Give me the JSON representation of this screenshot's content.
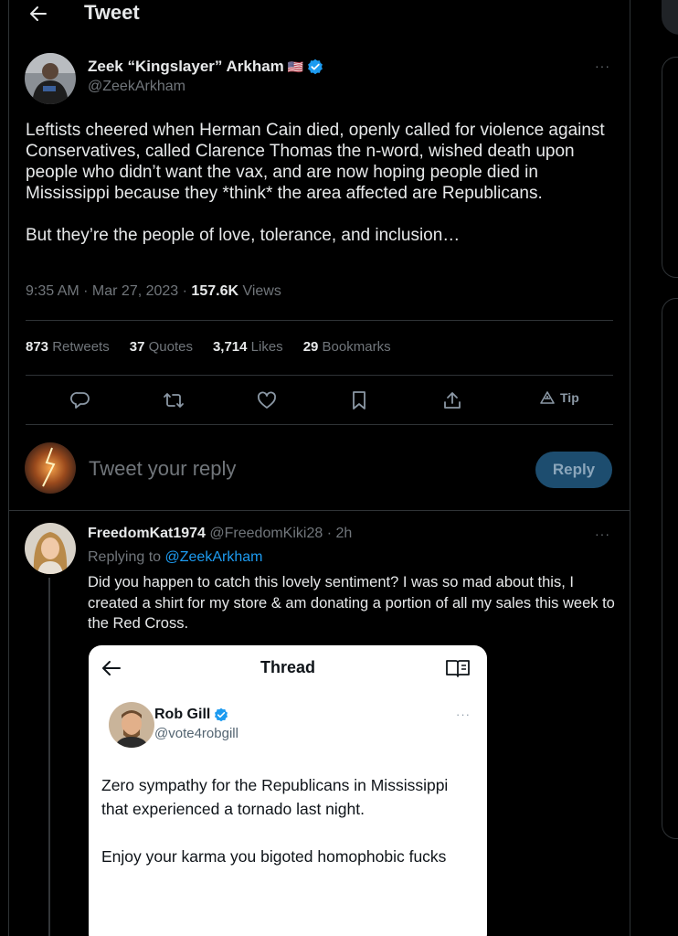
{
  "header": {
    "title": "Tweet"
  },
  "tweet": {
    "author_name": "Zeek “Kingslayer” Arkham",
    "author_flag": "🇺🇸",
    "author_handle": "@ZeekArkham",
    "more": "···",
    "text": "Leftists cheered when Herman Cain died, openly called for violence against Conservatives, called Clarence Thomas the n-word, wished death upon people who didn’t want the vax, and are now hoping people died in Mississippi because they *think* the area affected are Republicans.\n\nBut they’re the people of love, tolerance, and inclusion…",
    "time": "9:35 AM · Mar 27, 2023 · ",
    "views_count": "157.6K",
    "views_label": " Views",
    "stats": [
      {
        "count": "873",
        "label": " Retweets"
      },
      {
        "count": "37",
        "label": " Quotes"
      },
      {
        "count": "3,714",
        "label": " Likes"
      },
      {
        "count": "29",
        "label": " Bookmarks"
      }
    ],
    "tip_label": "Tip"
  },
  "compose": {
    "placeholder": "Tweet your reply",
    "button_label": "Reply"
  },
  "reply": {
    "name": "FreedomKat1974",
    "handle_time": " @FreedomKiki28 · 2h",
    "replying_prefix": "Replying to ",
    "replying_handle": "@ZeekArkham",
    "more": "···",
    "text": "Did you happen to catch this lovely sentiment? I was so mad about this, I created a shirt for my store & am donating a portion of all my sales this week to the Red Cross."
  },
  "embedded": {
    "title": "Thread",
    "name": "Rob Gill",
    "handle": "@vote4robgill",
    "more": "···",
    "text": "Zero sympathy for the Republicans in Mississippi that experienced a tornado last night.\n\nEnjoy your karma you bigoted homophobic fucks"
  },
  "colors": {
    "accent": "#1d9bf0",
    "background": "#000000",
    "muted": "#71767b",
    "verified": "#1d9bf0"
  }
}
